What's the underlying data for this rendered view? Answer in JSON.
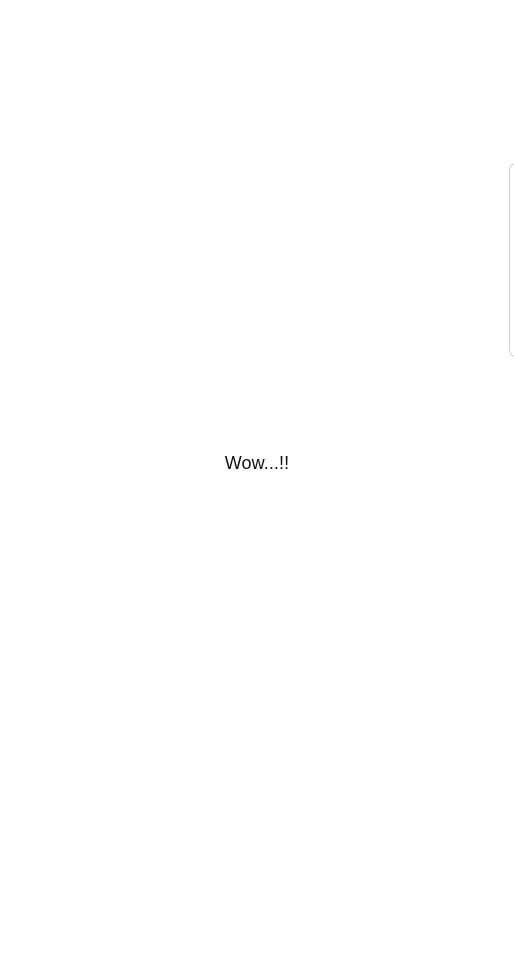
{
  "message": {
    "text": "Wow...!!"
  }
}
